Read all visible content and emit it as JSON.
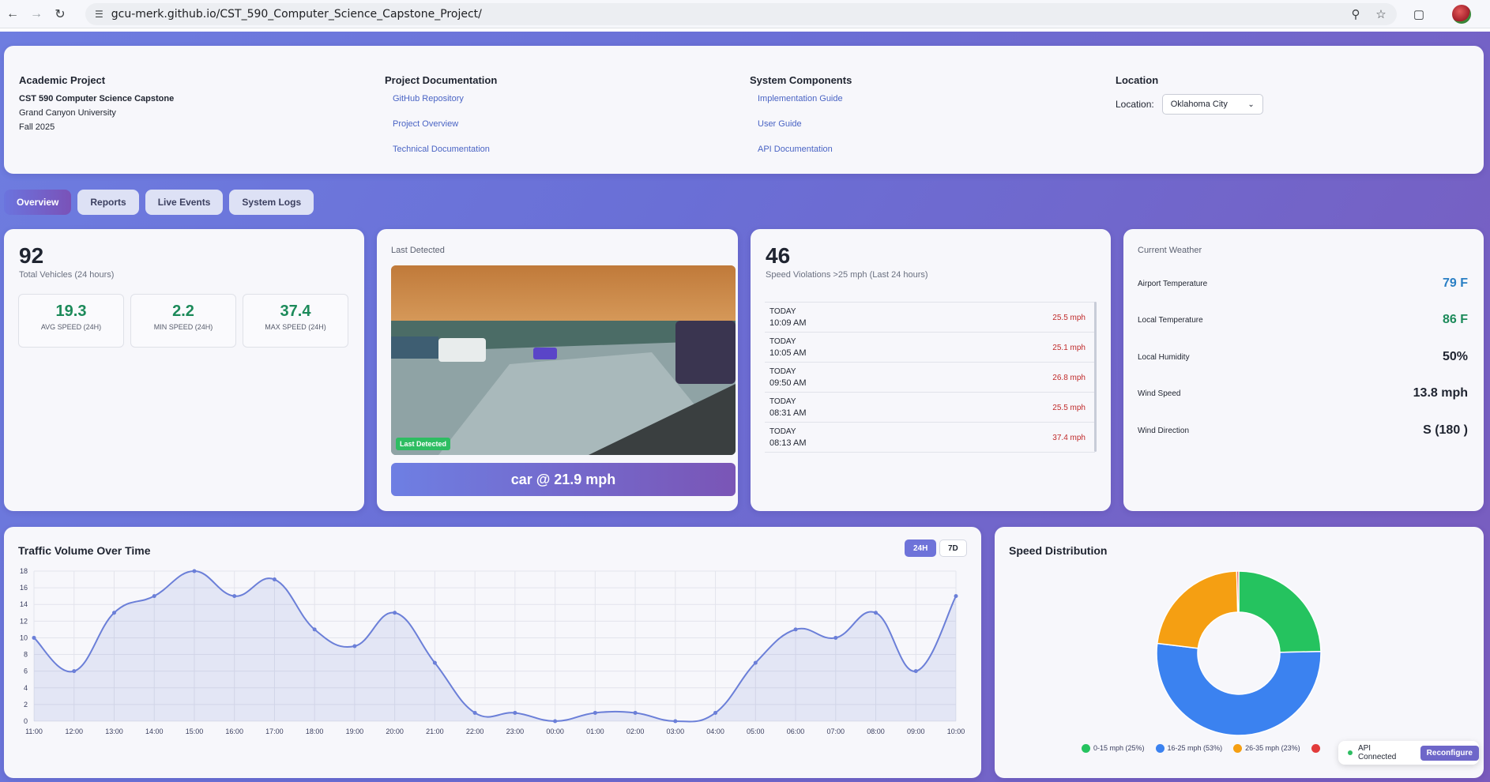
{
  "browser": {
    "url": "gcu-merk.github.io/CST_590_Computer_Science_Capstone_Project/"
  },
  "footer": {
    "academic": {
      "heading": "Academic Project",
      "course": "CST 590 Computer Science Capstone",
      "school": "Grand Canyon University",
      "term": "Fall 2025"
    },
    "docs": {
      "heading": "Project Documentation",
      "links": [
        "GitHub Repository",
        "Project Overview",
        "Technical Documentation"
      ]
    },
    "components": {
      "heading": "System Components",
      "links": [
        "Implementation Guide",
        "User Guide",
        "API Documentation"
      ]
    },
    "location": {
      "heading": "Location",
      "label": "Location:",
      "selected": "Oklahoma City"
    }
  },
  "tabs": [
    "Overview",
    "Reports",
    "Live Events",
    "System Logs"
  ],
  "vehicles": {
    "total": "92",
    "total_label": "Total Vehicles (24 hours)",
    "metrics": [
      {
        "value": "19.3",
        "label": "AVG SPEED (24H)"
      },
      {
        "value": "2.2",
        "label": "MIN SPEED (24H)"
      },
      {
        "value": "37.4",
        "label": "MAX SPEED (24H)"
      }
    ]
  },
  "last_detected": {
    "title": "Last Detected",
    "badge": "Last Detected",
    "detection": "car @ 21.9 mph"
  },
  "violations": {
    "count": "46",
    "label": "Speed Violations >25 mph (Last 24 hours)",
    "items": [
      {
        "day": "TODAY",
        "time": "10:09 AM",
        "speed": "25.5 mph"
      },
      {
        "day": "TODAY",
        "time": "10:05 AM",
        "speed": "25.1 mph"
      },
      {
        "day": "TODAY",
        "time": "09:50 AM",
        "speed": "26.8 mph"
      },
      {
        "day": "TODAY",
        "time": "08:31 AM",
        "speed": "25.5 mph"
      },
      {
        "day": "TODAY",
        "time": "08:13 AM",
        "speed": "37.4 mph"
      }
    ]
  },
  "weather": {
    "title": "Current Weather",
    "rows": [
      {
        "label": "Airport Temperature",
        "value": "79 F",
        "color": "#2a7fc4"
      },
      {
        "label": "Local Temperature",
        "value": "86 F",
        "color": "#1c8a5a"
      },
      {
        "label": "Local Humidity",
        "value": "50%",
        "color": "#1f2430"
      },
      {
        "label": "Wind Speed",
        "value": "13.8 mph",
        "color": "#1f2430"
      },
      {
        "label": "Wind Direction",
        "value": "S (180 )",
        "color": "#1f2430"
      }
    ]
  },
  "traffic": {
    "title": "Traffic Volume Over Time",
    "ranges": [
      "24H",
      "7D"
    ],
    "active_range": "24H"
  },
  "speed_dist": {
    "title": "Speed Distribution"
  },
  "api": {
    "status": "API Connected",
    "button": "Reconfigure"
  },
  "chart_data": [
    {
      "type": "area",
      "title": "Traffic Volume Over Time",
      "x": [
        "11:00",
        "12:00",
        "13:00",
        "14:00",
        "15:00",
        "16:00",
        "17:00",
        "18:00",
        "19:00",
        "20:00",
        "21:00",
        "22:00",
        "23:00",
        "00:00",
        "01:00",
        "02:00",
        "03:00",
        "04:00",
        "05:00",
        "06:00",
        "07:00",
        "08:00",
        "09:00",
        "10:00"
      ],
      "values": [
        10,
        6,
        13,
        15,
        18,
        15,
        17,
        11,
        9,
        13,
        7,
        1,
        1,
        0,
        1,
        1,
        0,
        1,
        7,
        11,
        10,
        13,
        6,
        15
      ],
      "ylim": [
        0,
        18
      ],
      "yticks": [
        0,
        2,
        4,
        6,
        8,
        10,
        12,
        14,
        16,
        18
      ],
      "grid": true,
      "color": "#6b7fd8"
    },
    {
      "type": "pie",
      "title": "Speed Distribution",
      "donut": true,
      "categories": [
        "0-15 mph (25%)",
        "16-25 mph (53%)",
        "26-35 mph (23%)",
        ""
      ],
      "values": [
        25,
        53,
        23,
        0.4
      ],
      "colors": [
        "#25c35f",
        "#3b82f0",
        "#f59f12",
        "#e23b3b"
      ],
      "legend": "bottom"
    }
  ]
}
